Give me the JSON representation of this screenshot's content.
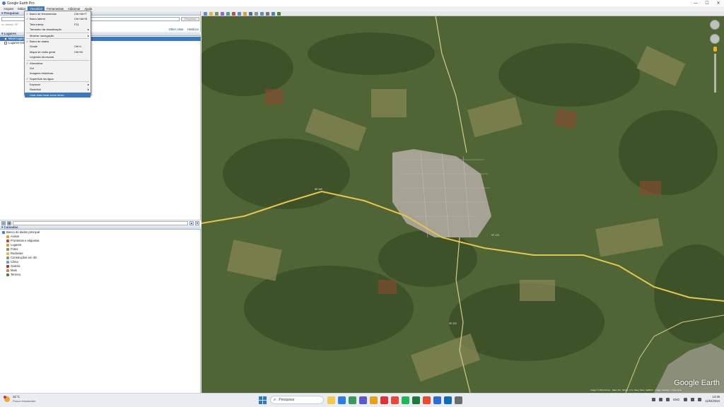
{
  "window": {
    "title": "Google Earth Pro",
    "controls": [
      "—",
      "☐",
      "✕"
    ]
  },
  "menubar": {
    "items": [
      {
        "label": "Arquivo",
        "active": false
      },
      {
        "label": "Editar",
        "active": false
      },
      {
        "label": "Visualizar",
        "active": true
      },
      {
        "label": "Ferramentas",
        "active": false
      },
      {
        "label": "Adicionar",
        "active": false
      },
      {
        "label": "Ajuda",
        "active": false
      }
    ]
  },
  "view_menu": {
    "items": [
      {
        "label": "Barra de ferramentas",
        "shortcut": "Ctrl+Alt+T",
        "checked": true,
        "submenu": false
      },
      {
        "label": "Barra lateral",
        "shortcut": "Ctrl+Alt+B",
        "checked": true,
        "submenu": false
      },
      {
        "label": "Tela inteira",
        "shortcut": "F11",
        "checked": false,
        "submenu": false
      },
      {
        "label": "Tamanho da visualização",
        "shortcut": "",
        "checked": false,
        "submenu": true
      },
      {
        "label": "Mostrar navegação",
        "shortcut": "",
        "checked": false,
        "submenu": true
      },
      {
        "label": "Barra de status",
        "shortcut": "",
        "checked": true,
        "submenu": false
      },
      {
        "label": "Grade",
        "shortcut": "Ctrl+L",
        "checked": false,
        "submenu": false
      },
      {
        "label": "Mapa de visão geral",
        "shortcut": "Ctrl+M",
        "checked": false,
        "submenu": false
      },
      {
        "label": "Legenda da escala",
        "shortcut": "",
        "checked": false,
        "submenu": false
      },
      {
        "label": "Atmosfera",
        "shortcut": "",
        "checked": true,
        "submenu": false
      },
      {
        "label": "Sol",
        "shortcut": "",
        "checked": false,
        "submenu": false
      },
      {
        "label": "Imagens históricas",
        "shortcut": "",
        "checked": false,
        "submenu": false
      },
      {
        "label": "Superfície da água",
        "shortcut": "",
        "checked": true,
        "submenu": false
      },
      {
        "label": "Explorar",
        "shortcut": "",
        "checked": false,
        "submenu": true
      },
      {
        "label": "Redefinir",
        "shortcut": "",
        "checked": false,
        "submenu": true
      },
      {
        "label": "Usar vista local como início",
        "shortcut": "",
        "checked": false,
        "submenu": false,
        "highlight": true
      }
    ]
  },
  "sidebar": {
    "search_header": "Pesquisar",
    "search_button": "Pesquisar",
    "history_label": "ex: Atibaia, SP",
    "get_directions": "Obter rotas",
    "history_link": "Histórico",
    "places_header": "Lugares",
    "places": [
      {
        "label": "Meus lugares",
        "selected": true
      },
      {
        "label": "Lugares temporários",
        "selected": false
      }
    ],
    "layers_header": "Camadas",
    "layers": [
      {
        "label": "Banco de dados principal",
        "color": "#4a7fc1"
      },
      {
        "label": "Avisos",
        "color": "#e0a030"
      },
      {
        "label": "Fronteiras e etiquetas",
        "color": "#c84040"
      },
      {
        "label": "Lugares",
        "color": "#d0a020"
      },
      {
        "label": "Fotos",
        "color": "#8a8a8a"
      },
      {
        "label": "Rodovias",
        "color": "#e0c040"
      },
      {
        "label": "Construções em 3D",
        "color": "#909090"
      },
      {
        "label": "Clima",
        "color": "#60a0d8"
      },
      {
        "label": "Galeria",
        "color": "#c03030"
      },
      {
        "label": "Mais",
        "color": "#e08030"
      },
      {
        "label": "Terreno",
        "color": "#4a8a3a"
      }
    ]
  },
  "map": {
    "brand": "Google Earth",
    "attribution": "Image © 2024 Airbus · Data SIO, NOAA, U.S. Navy, NGA, GEBCO · Image Landsat / Copernicus",
    "roads": [
      "BR-369",
      "SP-225",
      "SP-333"
    ]
  },
  "taskbar": {
    "weather_temp": "31°C",
    "weather_desc": "Pouco ensolarado",
    "search_placeholder": "Pesquisar",
    "lang": "ENG",
    "time": "13:48",
    "date": "11/04/2024",
    "app_colors": [
      "#f2c94c",
      "#2d7be5",
      "#3a9a5a",
      "#5a5ad0",
      "#e6a21a",
      "#d33",
      "#1db954",
      "#1f7a3a",
      "#ec4a2a",
      "#2b6cd8",
      "#0f6cbd",
      "#6b6b6b"
    ]
  }
}
